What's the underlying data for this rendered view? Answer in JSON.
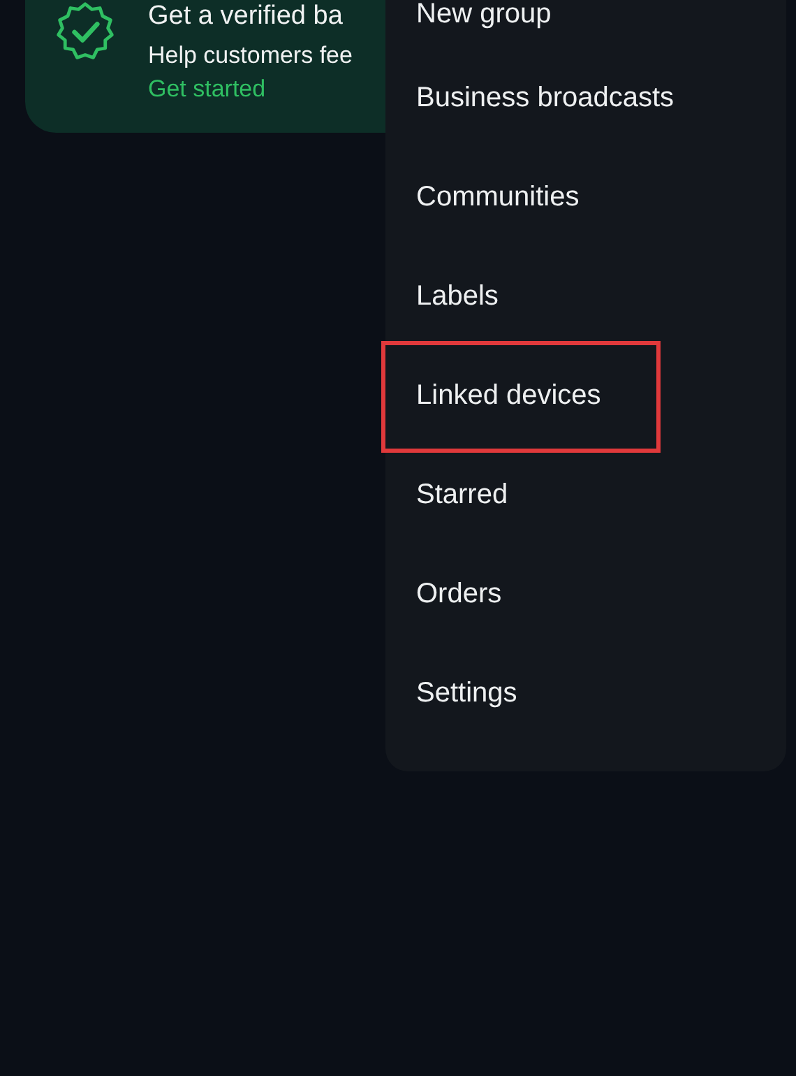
{
  "banner": {
    "title": "Get a verified ba",
    "subtitle": "Help customers fee",
    "link": "Get started"
  },
  "menu": {
    "items": [
      {
        "label": "New group",
        "highlighted": false
      },
      {
        "label": "Business broadcasts",
        "highlighted": false
      },
      {
        "label": "Communities",
        "highlighted": false
      },
      {
        "label": "Labels",
        "highlighted": false
      },
      {
        "label": "Linked devices",
        "highlighted": true
      },
      {
        "label": "Starred",
        "highlighted": false
      },
      {
        "label": "Orders",
        "highlighted": false
      },
      {
        "label": "Settings",
        "highlighted": false
      }
    ]
  }
}
